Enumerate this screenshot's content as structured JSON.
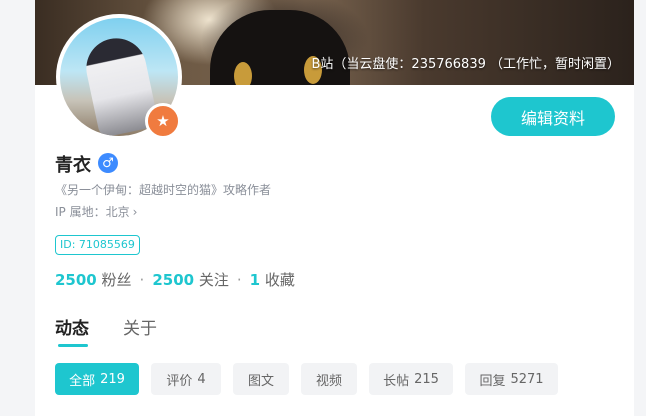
{
  "banner": {
    "note": "B站（当云盘使：235766839 （工作忙，暂时闲置）"
  },
  "profile": {
    "name": "青衣",
    "gender_symbol": "♂",
    "tagline": "《另一个伊甸：超越时空的猫》攻略作者",
    "ip_location": "IP 属地：北京",
    "ip_chevron": "›",
    "id_tag": "ID: 71085569",
    "edit_button": "编辑资料",
    "badge_symbol": "★"
  },
  "stats": [
    {
      "value": "2500",
      "label": "粉丝"
    },
    {
      "value": "2500",
      "label": "关注"
    },
    {
      "value": "1",
      "label": "收藏"
    }
  ],
  "stats_separator": "·",
  "tabs": [
    {
      "label": "动态",
      "active": true
    },
    {
      "label": "关于",
      "active": false
    }
  ],
  "filters": [
    {
      "label": "全部",
      "count": "219",
      "active": true
    },
    {
      "label": "评价",
      "count": "4",
      "active": false
    },
    {
      "label": "图文",
      "count": "",
      "active": false
    },
    {
      "label": "视频",
      "count": "",
      "active": false
    },
    {
      "label": "长帖",
      "count": "215",
      "active": false
    },
    {
      "label": "回复",
      "count": "5271",
      "active": false
    }
  ],
  "colors": {
    "accent": "#1ec6cf",
    "badge": "#f07b3f",
    "gender": "#3d8bff"
  },
  "icons": {
    "badge": "star-badge-icon",
    "gender": "male-icon",
    "chevron": "chevron-right-icon"
  }
}
